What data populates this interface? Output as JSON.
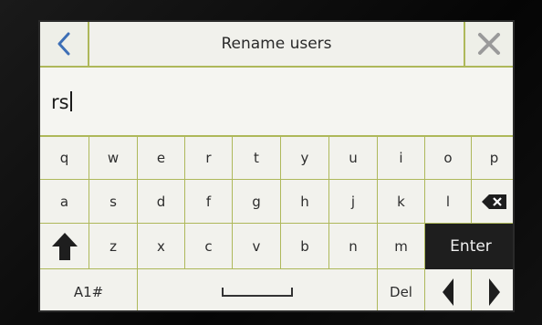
{
  "header": {
    "title": "Rename users",
    "back_icon": "chevron-left-icon",
    "close_icon": "close-x-icon"
  },
  "input": {
    "value": "rs"
  },
  "keyboard": {
    "row1": [
      "q",
      "w",
      "e",
      "r",
      "t",
      "y",
      "u",
      "i",
      "o",
      "p"
    ],
    "row2": [
      "a",
      "s",
      "d",
      "f",
      "g",
      "h",
      "j",
      "k",
      "l"
    ],
    "row3": [
      "z",
      "x",
      "c",
      "v",
      "b",
      "n",
      "m"
    ],
    "enter_label": "Enter",
    "mode_label": "A1#",
    "delete_label": "Del",
    "icons": {
      "backspace": "backspace-icon",
      "shift": "shift-up-arrow-icon",
      "space": "space-bar-icon",
      "left": "arrow-left-icon",
      "right": "arrow-right-icon"
    }
  },
  "colors": {
    "accent": "#aeb85a",
    "back_icon": "#3d6fb6",
    "dark_key": "#1e1e1e",
    "screen_bg": "#f3f3ee"
  }
}
